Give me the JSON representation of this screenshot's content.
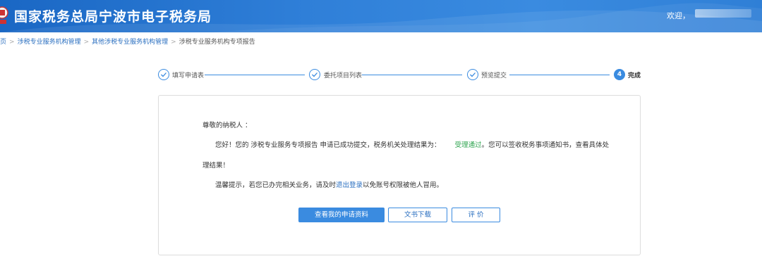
{
  "header": {
    "title": "国家税务总局宁波市电子税务局",
    "welcome": "欢迎，"
  },
  "breadcrumb": {
    "items": [
      "页",
      "涉税专业服务机构管理",
      "其他涉税专业服务机构管理"
    ],
    "separator": ">",
    "current": "涉税专业服务机构专项报告"
  },
  "steps": [
    {
      "label": "填写申请表",
      "status": "done"
    },
    {
      "label": "委托项目列表",
      "status": "done"
    },
    {
      "label": "预览提交",
      "status": "done"
    },
    {
      "label": "完成",
      "number": "4",
      "status": "active"
    }
  ],
  "message": {
    "greeting": "尊敬的纳税人 ：",
    "line1_prefix": "您好！您的 涉税专业服务专项报告 申请已成功提交，税务机关处理结果为：",
    "status": "受理通过",
    "line1_suffix": "。您可以签收税务事项通知书，查看具体处",
    "line2": "理结果！",
    "tip_prefix": "温馨提示，若您已办完相关业务，请及时",
    "tip_link": "退出登录",
    "tip_suffix": "以免账号权限被他人冒用。"
  },
  "buttons": {
    "view": "查看我的申请资料",
    "download": "文书下载",
    "evaluate": "评 价"
  },
  "colors": {
    "primary": "#3a8be0",
    "success": "#2ea44f",
    "link": "#2a6fc0"
  }
}
